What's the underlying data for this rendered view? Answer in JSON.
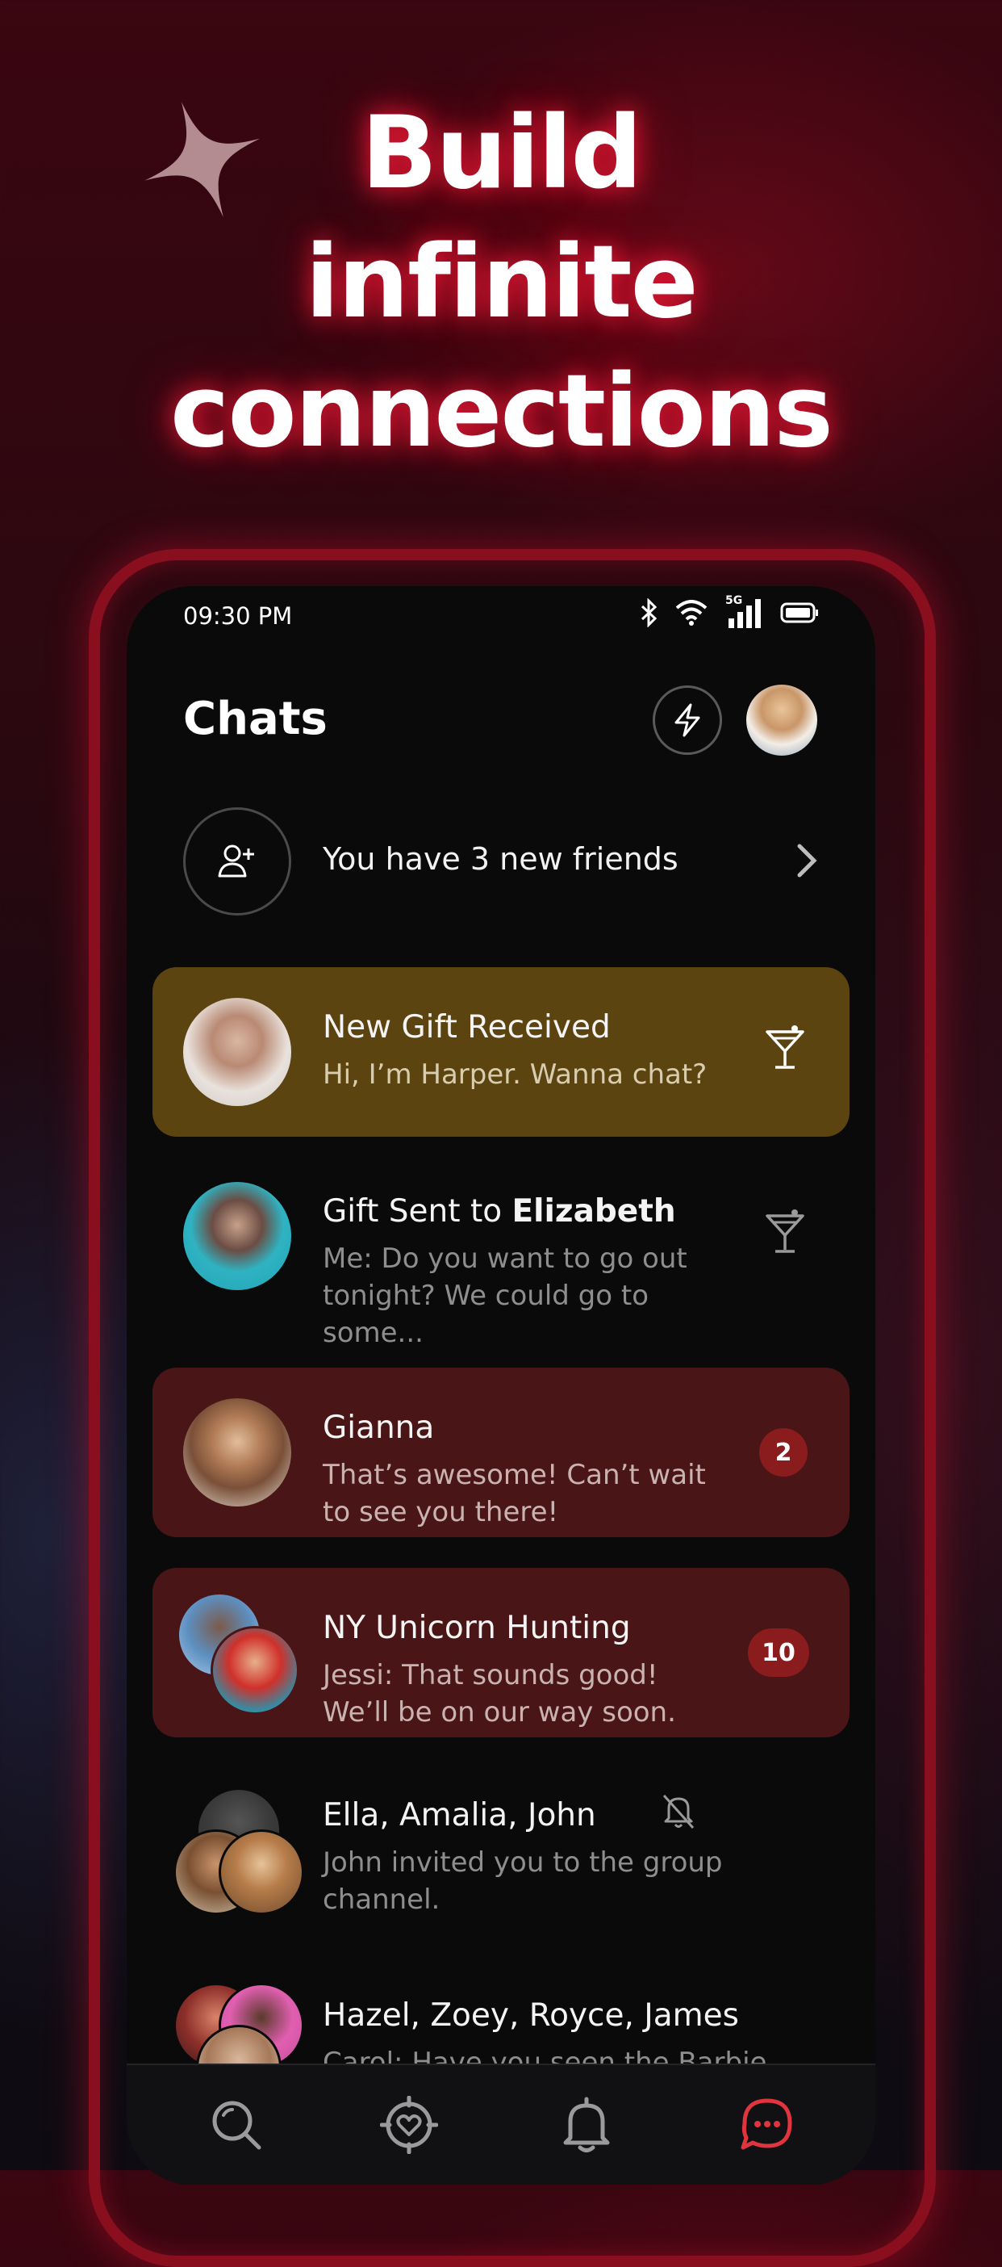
{
  "promo": {
    "headline_line1": "Build",
    "headline_line2": "infinite",
    "headline_line3": "connections"
  },
  "status_bar": {
    "time": "09:30 PM",
    "network": "5G",
    "icons": [
      "bluetooth-icon",
      "wifi-icon",
      "signal-icon",
      "battery-icon"
    ]
  },
  "header": {
    "title": "Chats",
    "boost_icon": "lightning-icon"
  },
  "friends_banner": {
    "text": "You have 3 new friends",
    "icon": "add-user-icon"
  },
  "chats": [
    {
      "name": "New Gift Received",
      "message": "Hi, I’m Harper. Wanna chat?",
      "style": "gold",
      "icon": "cocktail-icon"
    },
    {
      "name_prefix": "Gift Sent to ",
      "name_bold": "Elizabeth",
      "message": "Me: Do you want to go out tonight? We could go to some...",
      "style": "plain",
      "icon": "cocktail-icon"
    },
    {
      "name": "Gianna",
      "message": "That’s awesome! Can’t wait to see you there!",
      "style": "red",
      "unread": "2"
    },
    {
      "name": "NY Unicorn Hunting",
      "message": "Jessi: That sounds good! We’ll be on our way soon.",
      "style": "red",
      "unread": "10"
    },
    {
      "name": "Ella, Amalia, John",
      "message": "John invited you to the group channel.",
      "style": "plain",
      "icon": "muted-bell-icon"
    },
    {
      "name": "Hazel, Zoey, Royce, James",
      "message": "Carol: Have you seen the Barbie",
      "style": "plain"
    }
  ],
  "bottom_nav": [
    {
      "name": "search",
      "icon": "search-icon"
    },
    {
      "name": "discover",
      "icon": "heart-target-icon"
    },
    {
      "name": "notifications",
      "icon": "bell-icon"
    },
    {
      "name": "chats",
      "icon": "chat-icon",
      "active": true
    }
  ],
  "colors": {
    "accent": "#e0343f",
    "gold_card": "#5c4410",
    "red_card": "#4a1516",
    "badge": "#8a1c1e"
  }
}
